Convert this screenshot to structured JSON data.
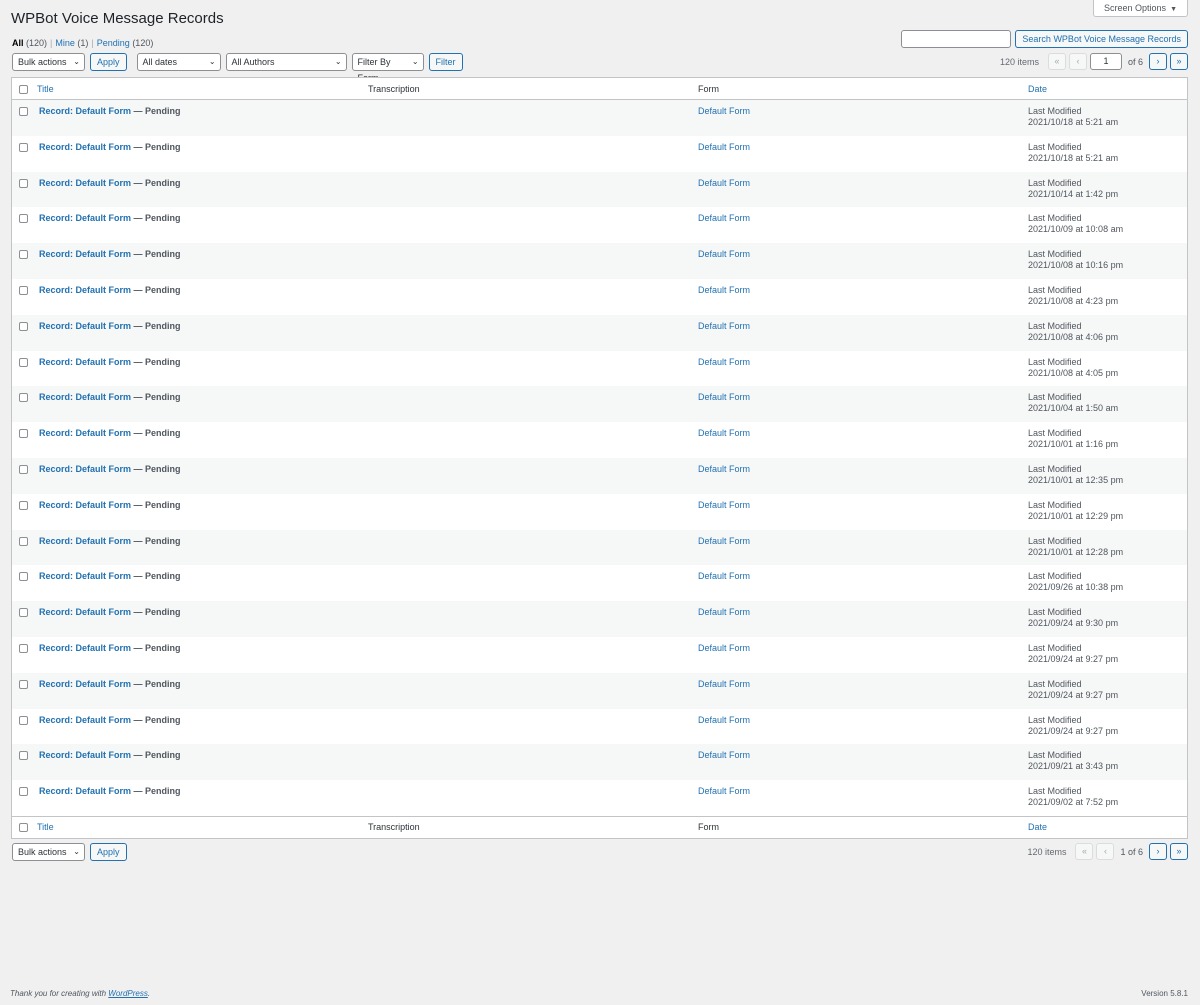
{
  "screen_options": "Screen Options",
  "page_title": "WPBot Voice Message Records",
  "views": [
    {
      "label": "All",
      "count": "(120)"
    },
    {
      "label": "Mine",
      "count": "(1)"
    },
    {
      "label": "Pending",
      "count": "(120)"
    }
  ],
  "search": {
    "value": "",
    "button": "Search WPBot Voice Message Records"
  },
  "tablenav_top": {
    "bulk_actions": "Bulk actions",
    "apply": "Apply",
    "dates": "All dates",
    "authors": "All Authors",
    "form_filter": "Filter By Form",
    "filter": "Filter",
    "items": "120 items",
    "first": "«",
    "prev": "‹",
    "current_page": "1",
    "of": "of 6",
    "next": "›",
    "last": "»"
  },
  "tablenav_bottom": {
    "bulk_actions": "Bulk actions",
    "apply": "Apply",
    "items": "120 items",
    "first": "«",
    "prev": "‹",
    "paging": "1 of 6",
    "next": "›",
    "last": "»"
  },
  "columns": {
    "title": "Title",
    "transcription": "Transcription",
    "form": "Form",
    "date": "Date"
  },
  "rows": [
    {
      "title": "Record: Default Form",
      "state": "— Pending",
      "form": "Default Form",
      "date_label": "Last Modified",
      "date": "2021/10/18 at 5:21 am"
    },
    {
      "title": "Record: Default Form",
      "state": "— Pending",
      "form": "Default Form",
      "date_label": "Last Modified",
      "date": "2021/10/18 at 5:21 am"
    },
    {
      "title": "Record: Default Form",
      "state": "— Pending",
      "form": "Default Form",
      "date_label": "Last Modified",
      "date": "2021/10/14 at 1:42 pm"
    },
    {
      "title": "Record: Default Form",
      "state": "— Pending",
      "form": "Default Form",
      "date_label": "Last Modified",
      "date": "2021/10/09 at 10:08 am"
    },
    {
      "title": "Record: Default Form",
      "state": "— Pending",
      "form": "Default Form",
      "date_label": "Last Modified",
      "date": "2021/10/08 at 10:16 pm"
    },
    {
      "title": "Record: Default Form",
      "state": "— Pending",
      "form": "Default Form",
      "date_label": "Last Modified",
      "date": "2021/10/08 at 4:23 pm"
    },
    {
      "title": "Record: Default Form",
      "state": "— Pending",
      "form": "Default Form",
      "date_label": "Last Modified",
      "date": "2021/10/08 at 4:06 pm"
    },
    {
      "title": "Record: Default Form",
      "state": "— Pending",
      "form": "Default Form",
      "date_label": "Last Modified",
      "date": "2021/10/08 at 4:05 pm"
    },
    {
      "title": "Record: Default Form",
      "state": "— Pending",
      "form": "Default Form",
      "date_label": "Last Modified",
      "date": "2021/10/04 at 1:50 am"
    },
    {
      "title": "Record: Default Form",
      "state": "— Pending",
      "form": "Default Form",
      "date_label": "Last Modified",
      "date": "2021/10/01 at 1:16 pm"
    },
    {
      "title": "Record: Default Form",
      "state": "— Pending",
      "form": "Default Form",
      "date_label": "Last Modified",
      "date": "2021/10/01 at 12:35 pm"
    },
    {
      "title": "Record: Default Form",
      "state": "— Pending",
      "form": "Default Form",
      "date_label": "Last Modified",
      "date": "2021/10/01 at 12:29 pm"
    },
    {
      "title": "Record: Default Form",
      "state": "— Pending",
      "form": "Default Form",
      "date_label": "Last Modified",
      "date": "2021/10/01 at 12:28 pm"
    },
    {
      "title": "Record: Default Form",
      "state": "— Pending",
      "form": "Default Form",
      "date_label": "Last Modified",
      "date": "2021/09/26 at 10:38 pm"
    },
    {
      "title": "Record: Default Form",
      "state": "— Pending",
      "form": "Default Form",
      "date_label": "Last Modified",
      "date": "2021/09/24 at 9:30 pm"
    },
    {
      "title": "Record: Default Form",
      "state": "— Pending",
      "form": "Default Form",
      "date_label": "Last Modified",
      "date": "2021/09/24 at 9:27 pm"
    },
    {
      "title": "Record: Default Form",
      "state": "— Pending",
      "form": "Default Form",
      "date_label": "Last Modified",
      "date": "2021/09/24 at 9:27 pm"
    },
    {
      "title": "Record: Default Form",
      "state": "— Pending",
      "form": "Default Form",
      "date_label": "Last Modified",
      "date": "2021/09/24 at 9:27 pm"
    },
    {
      "title": "Record: Default Form",
      "state": "— Pending",
      "form": "Default Form",
      "date_label": "Last Modified",
      "date": "2021/09/21 at 3:43 pm"
    },
    {
      "title": "Record: Default Form",
      "state": "— Pending",
      "form": "Default Form",
      "date_label": "Last Modified",
      "date": "2021/09/02 at 7:52 pm"
    }
  ],
  "footer": {
    "thanks_prefix": "Thank you for creating with ",
    "wordpress": "WordPress",
    "thanks_suffix": ".",
    "version": "Version 5.8.1"
  }
}
